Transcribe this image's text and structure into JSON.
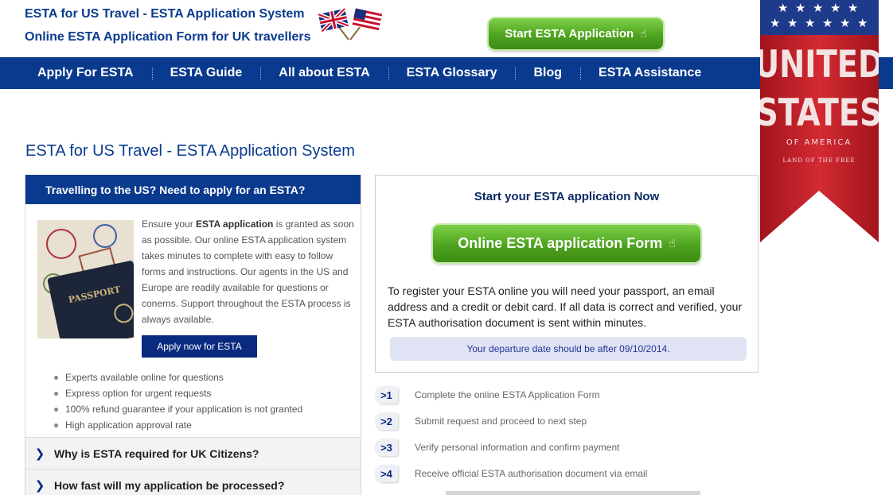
{
  "header": {
    "title_line1": "ESTA for US Travel - ESTA Application System",
    "title_line2": "Online ESTA Application Form for UK travellers",
    "start_button": "Start ESTA Application"
  },
  "nav": {
    "items": [
      "Apply For ESTA",
      "ESTA Guide",
      "All about ESTA",
      "ESTA Glossary",
      "Blog",
      "ESTA Assistance"
    ]
  },
  "banner": {
    "line1": "UNITED",
    "line2": "STATES",
    "line3": "OF AMERICA",
    "line4": "LAND OF THE FREE"
  },
  "main": {
    "heading": "ESTA for US Travel - ESTA Application System"
  },
  "left_panel": {
    "header": "Travelling to the US? Need to apply for an ESTA?",
    "intro_before": "Ensure your ",
    "intro_bold": "ESTA application",
    "intro_after": " is granted as soon as possible. Our online ESTA application system takes minutes to complete with easy to follow forms and instructions. Our agents in the US and Europe are readily available for questions or conerns. Support throughout the ESTA process is always available.",
    "apply_button": "Apply now for ESTA",
    "passport_label": "PASSPORT",
    "bullets": [
      "Experts available online for questions",
      "Express option for urgent requests",
      "100% refund guarantee if your application is not granted",
      "High application approval rate"
    ],
    "faq": [
      "Why is ESTA required for UK Citizens?",
      "How fast will my application be processed?"
    ]
  },
  "right_panel": {
    "title": "Start your ESTA application Now",
    "form_button": "Online ESTA application Form",
    "description": "To register your ESTA online you will need your passport, an email address and a credit or debit card. If all data is correct and verified, your ESTA authorisation document is sent within minutes.",
    "notice": "Your departure date should be after 09/10/2014."
  },
  "steps": [
    {
      "num": ">1",
      "text": "Complete the online ESTA Application Form"
    },
    {
      "num": ">2",
      "text": "Submit request and proceed to next step"
    },
    {
      "num": ">3",
      "text": "Verify personal information and confirm payment"
    },
    {
      "num": ">4",
      "text": "Receive official ESTA authorisation document via email"
    }
  ],
  "colors": {
    "brand_blue": "#0a3a8e",
    "button_green": "#4ea31f",
    "banner_red": "#c8202a"
  }
}
